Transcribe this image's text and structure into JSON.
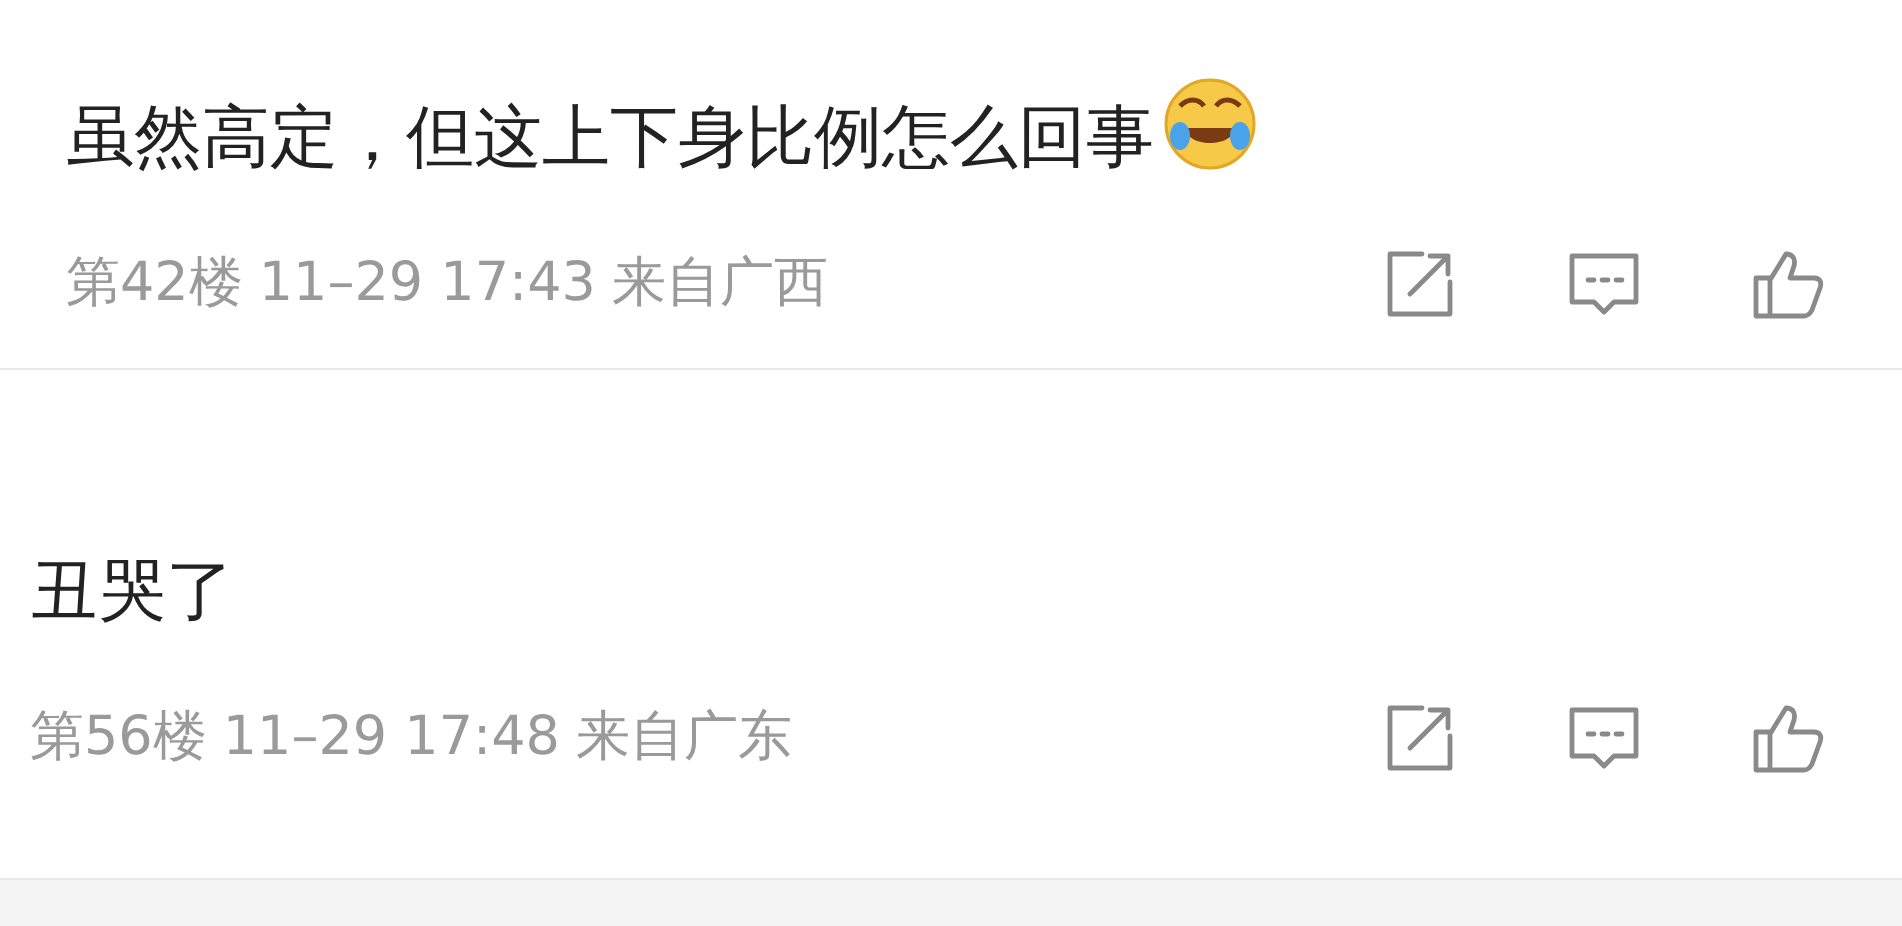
{
  "comments": [
    {
      "text": "虽然高定，但这上下身比例怎么回事",
      "emoji": true,
      "floor": "第42楼",
      "datetime": "11–29 17:43",
      "location": "来自广西"
    },
    {
      "text": "丑哭了",
      "emoji": false,
      "floor": "第56楼",
      "datetime": "11–29 17:48",
      "location": "来自广东"
    }
  ]
}
